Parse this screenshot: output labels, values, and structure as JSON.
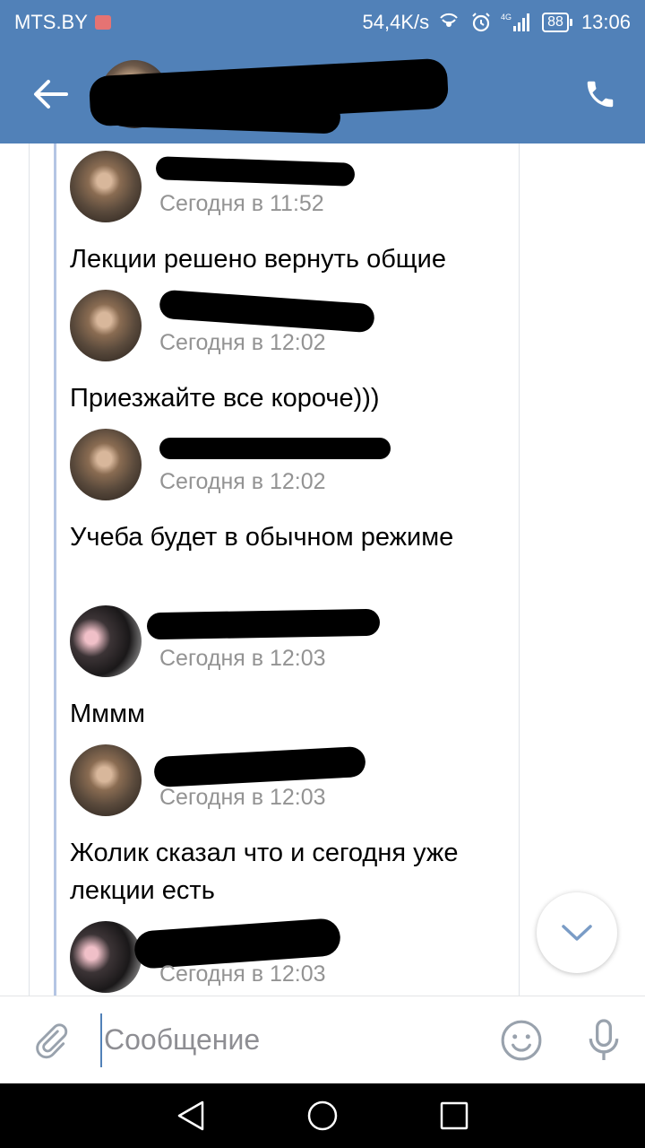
{
  "status_bar": {
    "carrier": "MTS.BY",
    "net_speed": "54,4K/s",
    "battery": "88",
    "time": "13:06"
  },
  "header": {
    "chat_title": ""
  },
  "messages": [
    {
      "author": "",
      "time": "Сегодня в 11:52",
      "text": "Лекции решено вернуть общие",
      "avatar": "avatar-a"
    },
    {
      "author": "",
      "time": "Сегодня в 12:02",
      "text": "Приезжайте все короче)))",
      "avatar": "avatar-a"
    },
    {
      "author": "",
      "time": "Сегодня в 12:02",
      "text": "Учеба будет в обычном режиме",
      "avatar": "avatar-a"
    },
    {
      "author": "",
      "time": "Сегодня в 12:03",
      "text": "Мммм",
      "avatar": "avatar-b"
    },
    {
      "author": "",
      "time": "Сегодня в 12:03",
      "text": "Жолик сказал что и сегодня уже лекции есть",
      "avatar": "avatar-a"
    },
    {
      "author": "",
      "time": "Сегодня в 12:03",
      "text": "",
      "avatar": "avatar-b"
    }
  ],
  "composer": {
    "placeholder": "Сообщение"
  },
  "colors": {
    "brand": "#5181b8",
    "link": "#4a76a8",
    "muted": "#939393"
  },
  "icons": [
    "back-arrow-icon",
    "phone-icon",
    "chevron-down-icon",
    "paperclip-icon",
    "smile-icon",
    "microphone-icon",
    "nav-back-icon",
    "nav-home-icon",
    "nav-recents-icon"
  ]
}
